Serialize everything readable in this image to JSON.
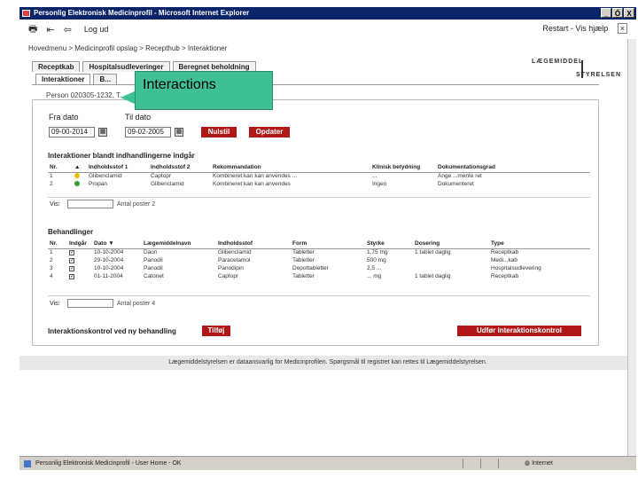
{
  "window": {
    "title": "Personlig Elektronisk Medicinprofil - Microsoft Internet Explorer",
    "controls": [
      "_",
      "Ő",
      "X"
    ]
  },
  "toolbar": {
    "logout_label": "Log ud",
    "right_label": "Restart - Vis hjælp"
  },
  "breadcrumb": "Hovedmenu > Medicinprofil opslag > Recepthub > Interaktioner",
  "logo": {
    "line1": "LÆGEMIDDEL",
    "line2": "STYRELSEN"
  },
  "tabs_row1": [
    "Receptkab",
    "Hospitalsudleveringer",
    "Beregnet beholdning"
  ],
  "tabs_row2": [
    "Interaktioner",
    "B..."
  ],
  "subtitle": "Person 020305-1232, T...",
  "callout": "Interactions",
  "date_filter": {
    "from_label": "Fra dato",
    "to_label": "Til dato",
    "from_value": "09-00-2014",
    "to_value": "09-02-2005",
    "reset_label": "Nulstil",
    "update_label": "Opdater"
  },
  "interactions": {
    "title": "Interaktioner blandt indhandlingerne indgår",
    "columns": [
      "Nr.",
      "▲",
      "Indholdsstof 1",
      "Indholdsstof 2",
      "Rekommandation",
      "Klinisk betydning",
      "Dokumentationsgrad"
    ],
    "rows": [
      {
        "nr": "1",
        "sev_color": "#e8c000",
        "c1": "Glibenclamid",
        "c2": "Captopr",
        "rec": "Kombineret kan kan anvendes ...",
        "kb": "...",
        "dok": "Ange ...mente ret"
      },
      {
        "nr": "2",
        "sev_color": "#30a030",
        "c1": "Propan",
        "c2": "Glibenclamid",
        "rec": "Kombineret kan kan anvendes",
        "kb": "Ingen",
        "dok": "Dokumenteret"
      }
    ],
    "vis_label": "Vis:",
    "count_label": "Antal poster 2"
  },
  "treatments": {
    "title": "Behandlinger",
    "columns": [
      "Nr.",
      "Indgår",
      "Dato ▼",
      "Lægemiddelnavn",
      "Indholdsstof",
      "Form",
      "Styrke",
      "Dosering",
      "Type"
    ],
    "rows": [
      {
        "nr": "1",
        "check": "✓",
        "dato": "10-10-2004",
        "navn": "Daon",
        "stof": "Glibenclamid",
        "form": "Tabletter",
        "styrke": "1,75 mg",
        "dos": "1 tablet daglig",
        "type": "Receptkab"
      },
      {
        "nr": "2",
        "check": "✓",
        "dato": "29-10-2004",
        "navn": "Panodil",
        "stof": "Paracetamol",
        "form": "Tabletter",
        "styrke": "500 mg",
        "dos": "",
        "type": "Medi...kab"
      },
      {
        "nr": "3",
        "check": "✓",
        "dato": "10-10-2004",
        "navn": "Panodil",
        "stof": "Panodipin",
        "form": "Depottabletter",
        "styrke": "2,5 ...",
        "dos": "",
        "type": "Hospitalsudlevering"
      },
      {
        "nr": "4",
        "check": "✓",
        "dato": "01-11-2004",
        "navn": "Catonet",
        "stof": "Captopr",
        "form": "Tabletter",
        "styrke": "... mg",
        "dos": "1 tablet daglig",
        "type": "Receptkab"
      }
    ],
    "vis_label": "Vis:",
    "count_label": "Antal poster 4"
  },
  "new_treatment": {
    "label": "Interaktionskontrol ved ny behandling",
    "add_label": "Tilføj",
    "run_label": "Udfør interaktionskontrol"
  },
  "footer": "Lægemiddelstyrelsen er dataansvarlig for Medicinprofilen. Spørgsmål til registret kan rettes til Lægemiddelstyrelsen.",
  "statusbar": {
    "text": "Personlig Elektronisk Medicinprofil - User Home - OK",
    "zone": "Internet"
  }
}
